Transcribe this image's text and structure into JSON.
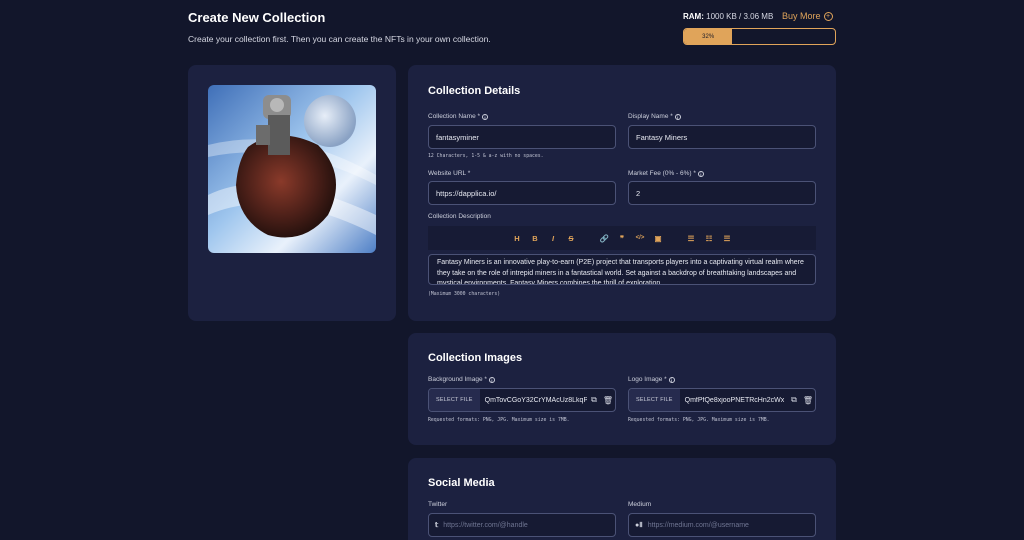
{
  "header": {
    "title": "Create New Collection",
    "subtitle": "Create your collection first. Then you can create the NFTs in your own collection.",
    "ram_label": "RAM:",
    "ram_value": "1000 KB / 3.06 MB",
    "buy_more": "Buy More",
    "ram_percent": 32,
    "ram_percent_label": "32%"
  },
  "details": {
    "title": "Collection Details",
    "collection_name_label": "Collection Name *",
    "collection_name_value": "fantasyminer",
    "collection_name_hint": "12 Characters, 1-5 & a-z with no spaces.",
    "display_name_label": "Display Name *",
    "display_name_value": "Fantasy Miners",
    "website_label": "Website URL *",
    "website_value": "https://dapplica.io/",
    "fee_label": "Market Fee (0% - 6%) *",
    "fee_value": "2",
    "description_label": "Collection Description",
    "description_text": "Fantasy Miners is an innovative play-to-earn (P2E) project that transports players into a captivating virtual realm where they take on the role of intrepid miners in a fantastical world. Set against a backdrop of breathtaking landscapes and mystical environments, Fantasy Miners combines the thrill of exploration",
    "description_hint": "(Maximum 3000 characters)",
    "toolbar": [
      "H",
      "B",
      "I",
      "S",
      "🔗",
      "❞",
      "</>",
      "▣",
      "☰",
      "☷",
      "☰"
    ]
  },
  "images": {
    "title": "Collection Images",
    "background_label": "Background Image *",
    "background_button": "SELECT FILE",
    "background_file": "QmTovCGoY32CrYMAcUz8LkqP",
    "logo_label": "Logo Image *",
    "logo_button": "SELECT FILE",
    "logo_file": "QmfPfQe8xjooPNETRcHn2cWx",
    "format_hint": "Requested formats: PNG, JPG. Maximum size is 7MB."
  },
  "social": {
    "title": "Social Media",
    "twitter_label": "Twitter",
    "twitter_placeholder": "https://twitter.com/@handle",
    "medium_label": "Medium",
    "medium_placeholder": "https://medium.com/@username"
  },
  "colors": {
    "accent": "#e0a45a",
    "card": "#1c2140",
    "background": "#12162b"
  }
}
